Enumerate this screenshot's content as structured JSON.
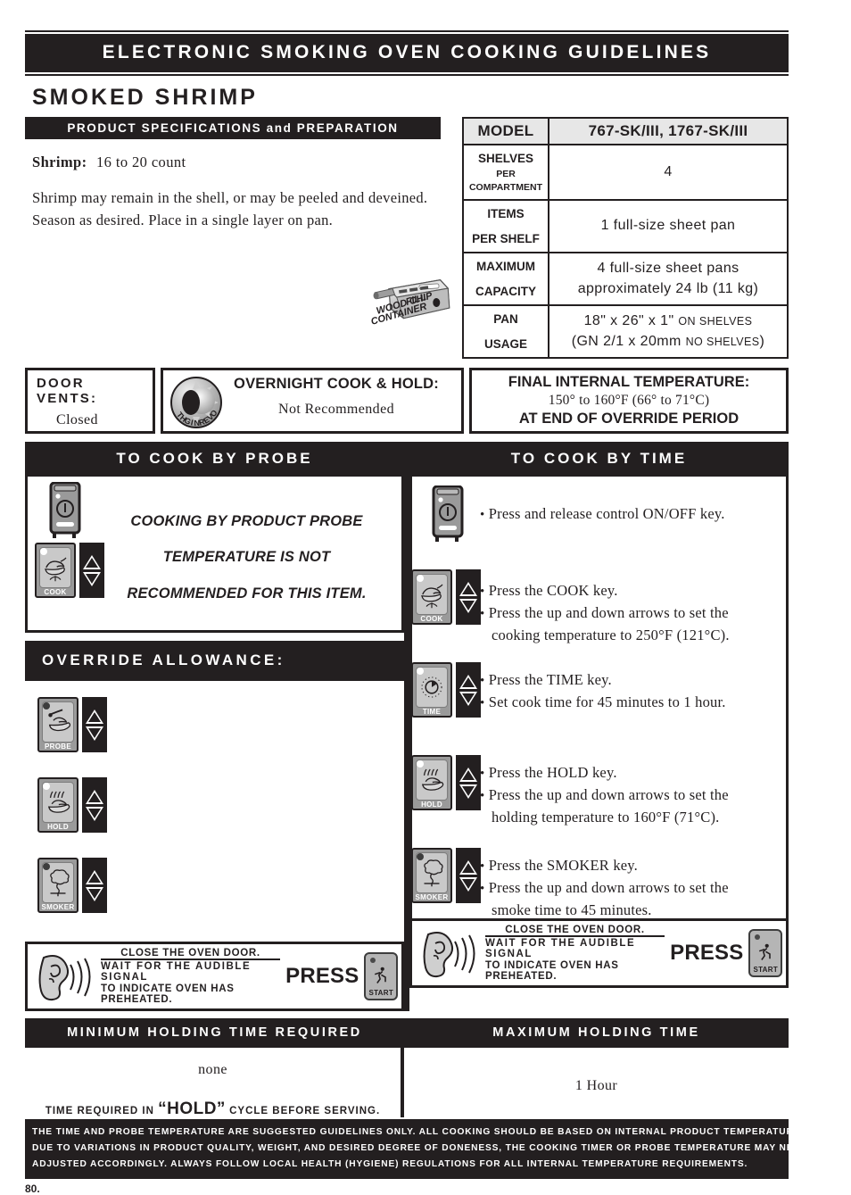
{
  "banner": {
    "title": "ELECTRONIC SMOKING OVEN COOKING GUIDELINES"
  },
  "recipe_title": "SMOKED SHRIMP",
  "prep": {
    "header": "PRODUCT SPECIFICATIONS and PREPARATION",
    "item_label": "Shrimp:",
    "item_value": "16 to 20 count",
    "instructions": "Shrimp may remain in the shell, or may be peeled and deveined.  Season as desired.  Place in a single layer on pan.",
    "woodchip_caption_1": "FILL",
    "woodchip_caption_2": "WOOD CHIP",
    "woodchip_caption_3": "CONTAINER"
  },
  "specs": {
    "model_label": "MODEL",
    "model_value": "767-SK/III, 1767-SK/III",
    "rows": [
      {
        "key_lines": [
          "SHELVES",
          "PER",
          "COMPARTMENT"
        ],
        "value": "4"
      },
      {
        "key_lines": [
          "ITEMS",
          "PER SHELF"
        ],
        "value": "1 full-size sheet pan"
      },
      {
        "key_lines": [
          "MAXIMUM",
          "CAPACITY"
        ],
        "value_line1": "4 full-size sheet pans",
        "value_line2": "approximately 24 lb (11 kg)"
      },
      {
        "key_lines": [
          "PAN",
          "USAGE"
        ],
        "value_line1_main": "18\" x 26\" x 1\"",
        "value_line1_sc": "ON SHELVES",
        "value_line2_main": "(GN 2/1 x 20mm",
        "value_line2_sc": "NO SHELVES",
        "value_line2_tail": ")"
      }
    ]
  },
  "door_vents": {
    "label_line1": "DOOR",
    "label_line2": "VENTS:",
    "value": "Closed"
  },
  "overnight": {
    "logo_text": "OVERNIGHT",
    "title": "OVERNIGHT COOK & HOLD:",
    "value": "Not Recommended"
  },
  "final_temp": {
    "title": "FINAL INTERNAL TEMPERATURE:",
    "value": "150° to 160°F (66° to 71°C)",
    "subtitle": "AT END OF OVERRIDE PERIOD"
  },
  "cook_by_probe": {
    "header": "TO COOK BY PROBE",
    "note_lines": [
      "COOKING BY PRODUCT PROBE",
      "TEMPERATURE IS NOT",
      "RECOMMENDED FOR THIS ITEM."
    ],
    "override_header": "OVERRIDE ALLOWANCE:",
    "keys": [
      "COOK",
      "PROBE",
      "HOLD",
      "SMOKER"
    ]
  },
  "cook_by_time": {
    "header": "TO COOK BY TIME",
    "steps": [
      {
        "key": "POWER",
        "lines": [
          "Press and release control ON/OFF key."
        ]
      },
      {
        "key": "COOK",
        "lines": [
          "Press the COOK key.",
          "Press the up and down arrows to set the cooking temperature to 250°F (121°C)."
        ]
      },
      {
        "key": "TIME",
        "lines": [
          "Press the TIME key.",
          "Set cook time for 45 minutes to 1 hour."
        ]
      },
      {
        "key": "HOLD",
        "lines": [
          "Press the HOLD key.",
          "Press the up and down arrows to set the holding temperature to 160°F (71°C)."
        ]
      },
      {
        "key": "SMOKER",
        "lines": [
          "Press the SMOKER key.",
          "Press the up and down arrows to set the smoke time to 45 minutes."
        ]
      }
    ]
  },
  "press_row": {
    "line1": "CLOSE THE OVEN DOOR.",
    "line2": "WAIT FOR THE AUDIBLE SIGNAL",
    "line3": "TO INDICATE OVEN HAS PREHEATED.",
    "press_word": "PRESS",
    "start_label": "START"
  },
  "holding": {
    "min_header": "MINIMUM HOLDING TIME REQUIRED",
    "max_header": "MAXIMUM HOLDING TIME",
    "min_value": "none",
    "min_note_pre": "TIME REQUIRED IN",
    "min_note_big": "“HOLD”",
    "min_note_post": "CYCLE BEFORE SERVING.",
    "max_value": "1 Hour"
  },
  "disclaimer": {
    "line1": "THE TIME AND PROBE TEMPERATURE ARE SUGGESTED GUIDELINES ONLY.   ALL COOKING SHOULD BE BASED ON INTERNAL PRODUCT TEMPERATURES.",
    "line2": "DUE TO VARIATIONS IN PRODUCT QUALITY, WEIGHT, AND DESIRED DEGREE OF DONENESS, THE COOKING TIMER OR PROBE TEMPERATURE MAY NEED TO BE",
    "line3": "ADJUSTED ACCORDINGLY.  ALWAYS FOLLOW LOCAL HEALTH (HYGIENE) REGULATIONS FOR ALL INTERNAL TEMPERATURE REQUIREMENTS."
  },
  "page_number": "80.",
  "colors": {
    "ink": "#231f20",
    "paper": "#ffffff",
    "panel_gray": "#e7e7e7",
    "key_gray": "#c9c9c9"
  }
}
